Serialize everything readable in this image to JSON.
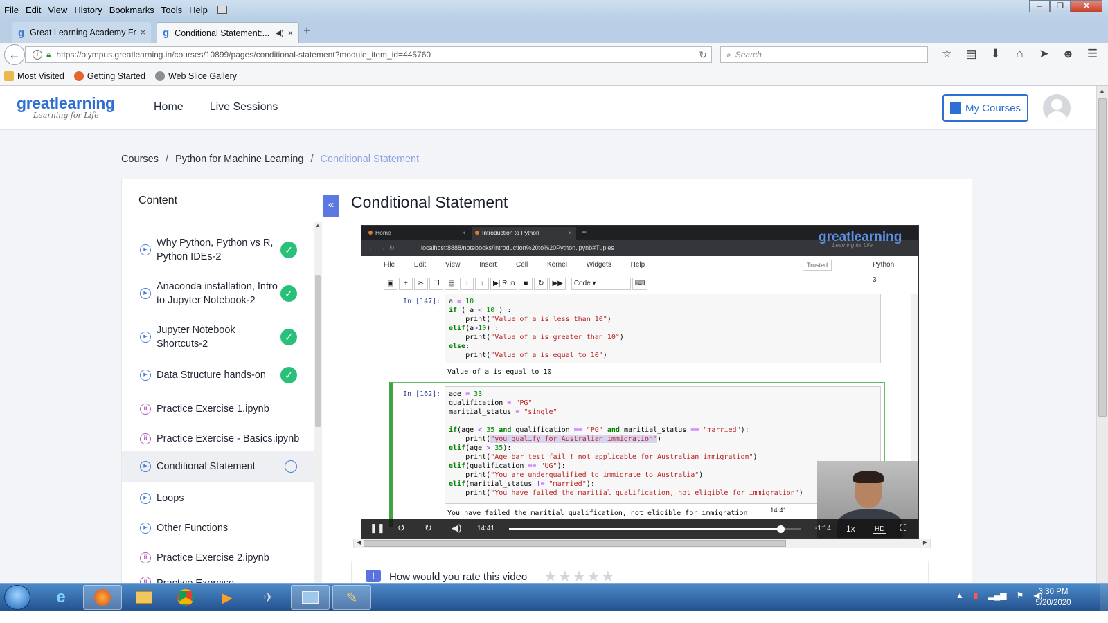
{
  "browser": {
    "menu": [
      "File",
      "Edit",
      "View",
      "History",
      "Bookmarks",
      "Tools",
      "Help"
    ],
    "window_controls": [
      "–",
      "❐",
      "✕"
    ],
    "tabs": [
      {
        "title": "Great Learning Academy Fr...",
        "close": "×"
      },
      {
        "title": "Conditional Statement:...",
        "close": "×"
      }
    ],
    "new_tab": "+",
    "url": "https://olympus.greatlearning.in/courses/10899/pages/conditional-statement?module_item_id=445760",
    "search_placeholder": "Search",
    "bookmarks": [
      "Most Visited",
      "Getting Started",
      "Web Slice Gallery"
    ]
  },
  "site": {
    "logo_main": "greatlearning",
    "logo_tagline": "Learning for Life",
    "nav": [
      "Home",
      "Live Sessions"
    ],
    "my_courses": "My Courses"
  },
  "breadcrumb": [
    "Courses",
    "Python for Machine Learning",
    "Conditional Statement"
  ],
  "sidebar": {
    "heading": "Content",
    "collapse": "«",
    "items": [
      {
        "label": "Why Python, Python vs R, Python IDEs-2",
        "type": "video",
        "status": "done"
      },
      {
        "label": "Anaconda installation, Intro to Jupyter Notebook-2",
        "type": "video",
        "status": "done"
      },
      {
        "label": "Jupyter Notebook Shortcuts-2",
        "type": "video",
        "status": "done"
      },
      {
        "label": "Data Structure hands-on",
        "type": "video",
        "status": "done"
      },
      {
        "label": "Practice Exercise 1.ipynb",
        "type": "notebook",
        "status": ""
      },
      {
        "label": "Practice Exercise - Basics.ipynb",
        "type": "notebook",
        "status": ""
      },
      {
        "label": "Conditional Statement",
        "type": "video",
        "status": "in-progress"
      },
      {
        "label": "Loops",
        "type": "video",
        "status": ""
      },
      {
        "label": "Other Functions",
        "type": "video",
        "status": ""
      },
      {
        "label": "Practice Exercise 2.ipynb",
        "type": "notebook",
        "status": ""
      },
      {
        "label": "Practice Exercise ...",
        "type": "notebook",
        "status": ""
      }
    ]
  },
  "lesson": {
    "title": "Conditional Statement",
    "rating_prompt": "How would you rate this video",
    "stars": "★★★★★"
  },
  "video": {
    "inner_tabs": [
      "Home",
      "Introduction to Python"
    ],
    "inner_url": "localhost:8888/notebooks/Introduction%20to%20Python.ipynb#Tuples",
    "watermark": "greatlearning",
    "watermark_sub": "Learning for Life",
    "jupyter_menu": [
      "File",
      "Edit",
      "View",
      "Insert",
      "Cell",
      "Kernel",
      "Widgets",
      "Help"
    ],
    "trusted": "Trusted",
    "kernel": "Python 3",
    "run_label": "Run",
    "cell_type": "Code",
    "cell1_prompt": "In [147]:",
    "cell1_output": "Value of a is equal to 10",
    "cell2_prompt": "In [162]:",
    "cell2_output": "You have failed the maritial qualification, not eligible for immigration",
    "elapsed": "14:41",
    "hover_time": "14:41",
    "remaining": "-1:14",
    "speed": "1x",
    "progress": 0.93
  },
  "taskbar": {
    "time": "3:30 PM",
    "date": "5/20/2020"
  }
}
